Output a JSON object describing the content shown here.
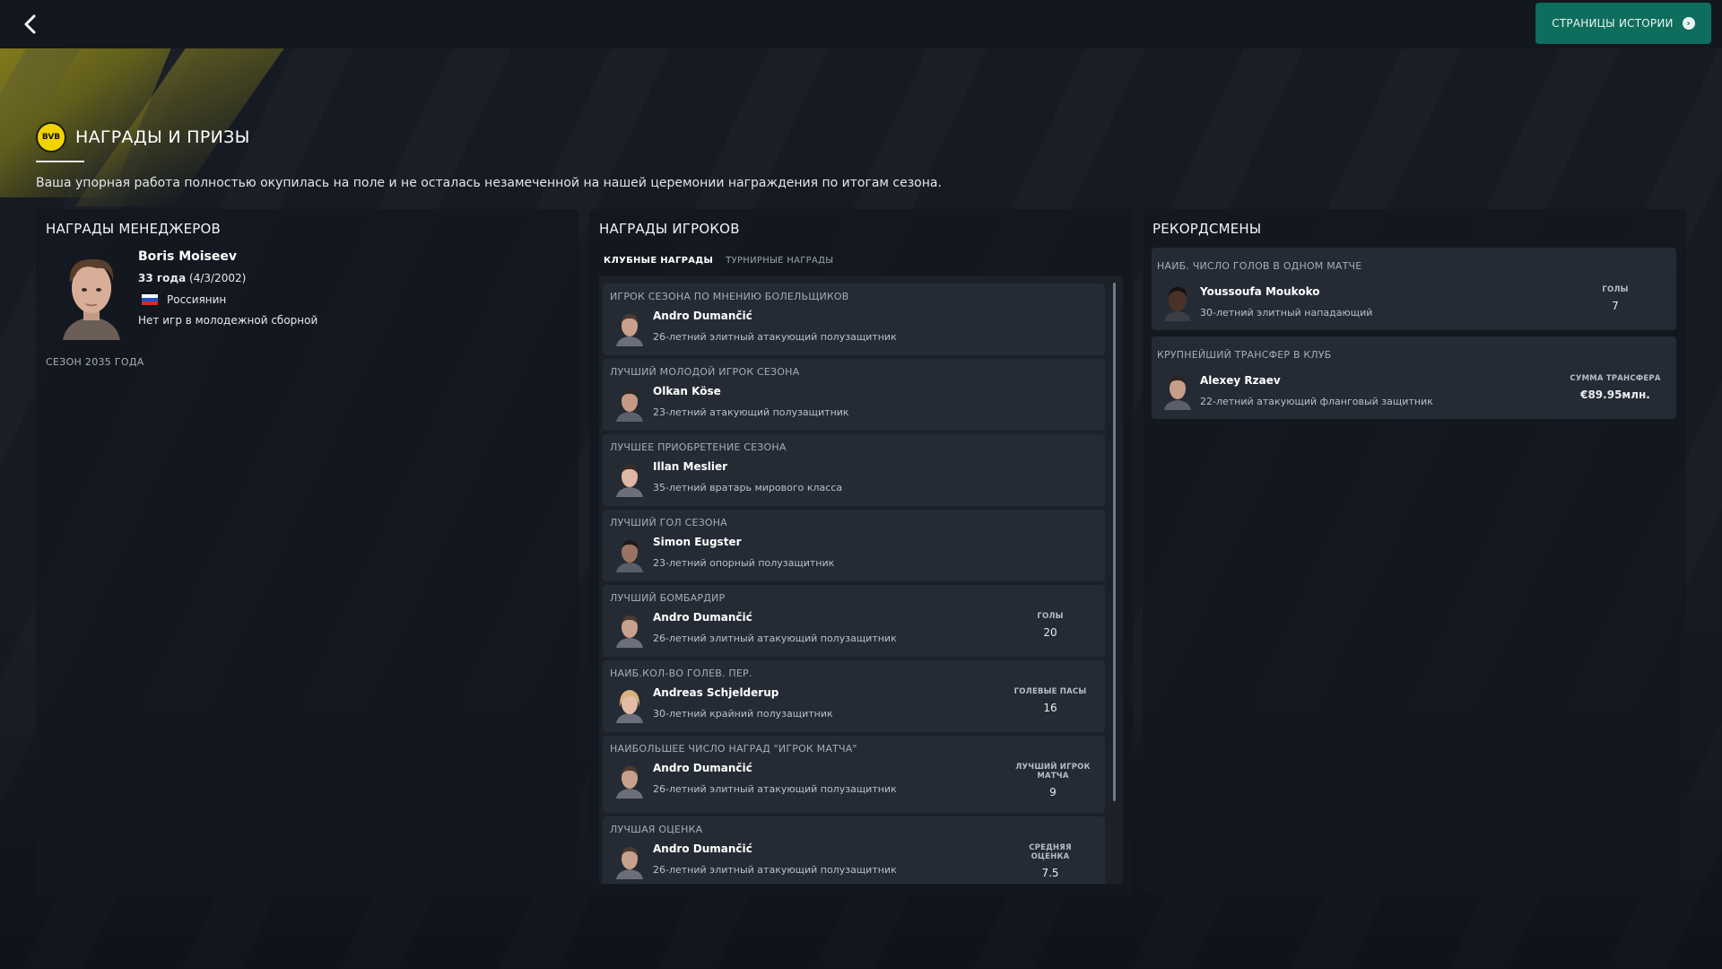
{
  "header": {
    "back_label": "‹",
    "story_button_label": "СТРАНИЦЫ ИСТОРИИ"
  },
  "page": {
    "club_badge_text": "BVB 09",
    "title": "НАГРАДЫ И ПРИЗЫ",
    "subtitle": "Ваша упорная работа полностью окупилась на поле и не осталась незамеченной на нашей церемонии награждения по итогам сезона."
  },
  "manager_panel": {
    "title": "НАГРАДЫ МЕНЕДЖЕРОВ",
    "name": "Boris Moiseev",
    "age_bold": "33 года",
    "dob": "(4/3/2002)",
    "nationality": "Россиянин",
    "youth": "Нет игр в молодежной сборной",
    "season": "СЕЗОН 2035 ГОДА"
  },
  "player_panel": {
    "title": "НАГРАДЫ ИГРОКОВ",
    "tabs": [
      {
        "label": "КЛУБНЫЕ НАГРАДЫ",
        "active": true
      },
      {
        "label": "ТУРНИРНЫЕ НАГРАДЫ",
        "active": false
      }
    ],
    "awards": [
      {
        "label": "ИГРОК СЕЗОНА ПО МНЕНИЮ БОЛЕЛЬЩИКОВ",
        "name": "Andro Dumančić",
        "desc": "26-летний элитный атакующий полузащитник",
        "stat_label": "",
        "stat_value": ""
      },
      {
        "label": "ЛУЧШИЙ МОЛОДОЙ ИГРОК СЕЗОНА",
        "name": "Olkan Köse",
        "desc": "23-летний атакующий полузащитник",
        "stat_label": "",
        "stat_value": ""
      },
      {
        "label": "ЛУЧШЕЕ ПРИОБРЕТЕНИЕ СЕЗОНА",
        "name": "Illan Meslier",
        "desc": "35-летний вратарь мирового класса",
        "stat_label": "",
        "stat_value": ""
      },
      {
        "label": "ЛУЧШИЙ ГОЛ СЕЗОНА",
        "name": "Simon Eugster",
        "desc": "23-летний опорный полузащитник",
        "stat_label": "",
        "stat_value": ""
      },
      {
        "label": "ЛУЧШИЙ БОМБАРДИР",
        "name": "Andro Dumančić",
        "desc": "26-летний элитный атакующий полузащитник",
        "stat_label": "ГОЛЫ",
        "stat_value": "20"
      },
      {
        "label": "НАИБ.КОЛ-ВО ГОЛЕВ. ПЕР.",
        "name": "Andreas Schjelderup",
        "desc": "30-летний крайний полузащитник",
        "stat_label": "ГОЛЕВЫЕ ПАСЫ",
        "stat_value": "16"
      },
      {
        "label": "НАИБОЛЬШЕЕ ЧИСЛО НАГРАД \"ИГРОК МАТЧА\"",
        "name": "Andro Dumančić",
        "desc": "26-летний элитный атакующий полузащитник",
        "stat_label": "ЛУЧШИЙ ИГРОК МАТЧА",
        "stat_value": "9"
      },
      {
        "label": "ЛУЧШАЯ ОЦЕНКА",
        "name": "Andro Dumančić",
        "desc": "26-летний элитный атакующий полузащитник",
        "stat_label": "СРЕДНЯЯ ОЦЕНКА",
        "stat_value": "7.5"
      }
    ]
  },
  "records_panel": {
    "title": "РЕКОРДСМЕНЫ",
    "records": [
      {
        "label": "НАИБ. ЧИСЛО ГОЛОВ В ОДНОМ МАТЧЕ",
        "name": "Youssoufa Moukoko",
        "desc": "30-летний элитный нападающий",
        "stat_label": "ГОЛЫ",
        "stat_value": "7"
      },
      {
        "label": "КРУПНЕЙШИЙ ТРАНСФЕР В КЛУБ",
        "name": "Alexey Rzaev",
        "desc": "22-летний атакующий фланговый защитник",
        "stat_label": "СУММА ТРАНСФЕРА",
        "stat_value": "€89.95млн."
      }
    ]
  },
  "colors": {
    "background": "#161b23",
    "panel": "#14181f",
    "card": "#252b35",
    "accent_green": "#0e6d5c",
    "club_yellow": "#f2d300"
  }
}
